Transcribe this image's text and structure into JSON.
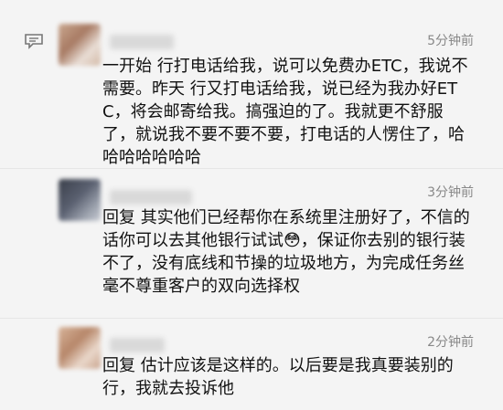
{
  "comments": [
    {
      "time": "5分钟前",
      "text": "一开始 行打电话给我，说可以免费办ETC，我说不需要。昨天 行又打电话给我，说已经为我办好ETC，将会邮寄给我。搞强迫的了。我就更不舒服了，就说我不要不要不要，打电话的人愣住了，哈哈哈哈哈哈哈"
    },
    {
      "time": "3分钟前",
      "text": "回复 其实他们已经帮你在系统里注册好了，不信的话你可以去其他银行试试😳，保证你去别的银行装不了，没有底线和节操的垃圾地方，为完成任务丝毫不尊重客户的双向选择权"
    },
    {
      "time": "2分钟前",
      "text": "回复 估计应该是这样的。以后要是我真要装别的行，我就去投诉他"
    }
  ],
  "icons": {
    "comment": "comment-bubble-icon"
  },
  "colors": {
    "background": "#f4f4f4",
    "text": "#111111",
    "time": "#888888"
  }
}
